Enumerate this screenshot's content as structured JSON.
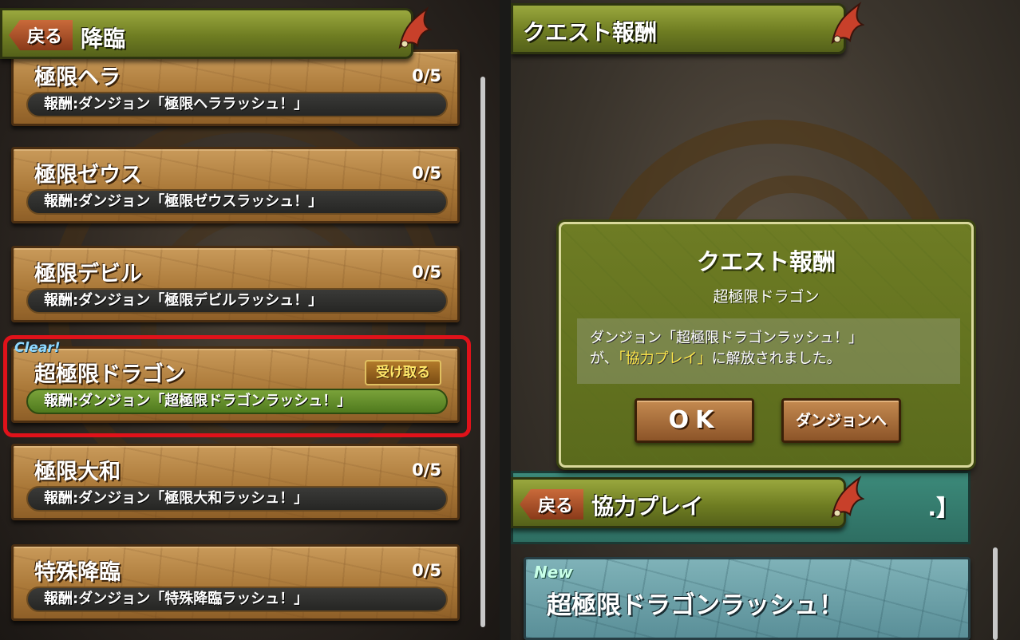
{
  "left": {
    "back_label": "戻る",
    "title": "降臨",
    "clear_badge": "Clear!",
    "quests": [
      {
        "name": "極限ヘラ",
        "progress": "0/5",
        "reward": "報酬:ダンジョン「極限ヘララッシュ！」"
      },
      {
        "name": "極限ゼウス",
        "progress": "0/5",
        "reward": "報酬:ダンジョン「極限ゼウスラッシュ！」"
      },
      {
        "name": "極限デビル",
        "progress": "0/5",
        "reward": "報酬:ダンジョン「極限デビルラッシュ！」"
      },
      {
        "name": "超極限ドラゴン",
        "receive_label": "受け取る",
        "reward": "報酬:ダンジョン「超極限ドラゴンラッシュ！」"
      },
      {
        "name": "極限大和",
        "progress": "0/5",
        "reward": "報酬:ダンジョン「極限大和ラッシュ！」"
      },
      {
        "name": "特殊降臨",
        "progress": "0/5",
        "reward": "報酬:ダンジョン「特殊降臨ラッシュ！」"
      }
    ]
  },
  "right": {
    "title": "クエスト報酬",
    "dialog": {
      "title": "クエスト報酬",
      "subtitle": "超極限ドラゴン",
      "message_line1": "ダンジョン「超極限ドラゴンラッシュ！」",
      "message_line2_prefix": "が、",
      "message_highlight": "「協力プレイ」",
      "message_line2_suffix": "に解放されました。",
      "ok_label": "OK",
      "dungeon_label": "ダンジョンへ"
    },
    "back_label": "戻る",
    "mid_title": "協力プレイ",
    "teal_strip_text": ".】",
    "new_badge": "New",
    "new_card_title": "超極限ドラゴンラッシュ！"
  },
  "colors": {
    "header_green": "#6f7d22",
    "card_brown": "#a87636",
    "highlight_red": "#e0121a",
    "message_yellow": "#ffe84a",
    "new_card_blue": "#5a8f98"
  },
  "icons": {
    "header_ornament": "dragon-wing-icon",
    "back_arrow": "back-arrow-icon"
  }
}
